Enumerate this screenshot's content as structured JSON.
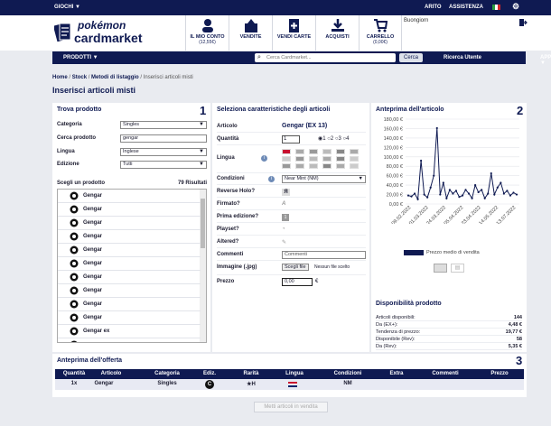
{
  "topbar": {
    "games": "GIOCHI ▼",
    "login": "ARITO",
    "assistance": "ASSISTENZA"
  },
  "header": {
    "logo_top": "pokémon",
    "logo_bottom": "cardmarket",
    "welcome": "Buongiorn",
    "nav": [
      {
        "label": "IL MIO CONTO",
        "sub": "(12,55€)",
        "icon": "user-icon"
      },
      {
        "label": "VENDITE",
        "sub": "",
        "icon": "sell-icon"
      },
      {
        "label": "VENDI CARTE",
        "sub": "",
        "icon": "add-card-icon"
      },
      {
        "label": "ACQUISTI",
        "sub": "",
        "icon": "download-icon"
      },
      {
        "label": "CARRELLO",
        "sub": "(0,00€)",
        "icon": "cart-icon"
      }
    ]
  },
  "menubar": {
    "products": "PRODOTTI ▼",
    "search_placeholder": "Cerca Cardmarket...",
    "search_button": "Cerca",
    "users": "Ricerca Utente",
    "apps": "APPS ▼"
  },
  "breadcrumb": {
    "home": "Home",
    "stock": "Stock",
    "method": "Metodi di listaggio",
    "current": "Inserisci articoli misti"
  },
  "page_title": "Inserisci articoli misti",
  "find_product": {
    "title": "Trova prodotto",
    "number": "1",
    "fields": [
      {
        "label": "Categoria",
        "value": "Singles",
        "type": "select"
      },
      {
        "label": "Cerca prodotto",
        "value": "gengar",
        "type": "input"
      },
      {
        "label": "Lingua",
        "value": "Inglese",
        "type": "select"
      },
      {
        "label": "Edizione",
        "value": "Tutti",
        "type": "select"
      }
    ],
    "results_label": "Scegli un prodotto",
    "results_count": "79 Risultati",
    "results": [
      "Gengar",
      "Gengar",
      "Gengar",
      "Gengar",
      "Gengar",
      "Gengar",
      "Gengar",
      "Gengar",
      "Gengar",
      "Gengar",
      "Gengar ex",
      "Gengar EX"
    ]
  },
  "attributes": {
    "title": "Seleziona caratteristiche degli articoli",
    "article_label": "Articolo",
    "article_value": "Gengar (EX 13)",
    "quantity_label": "Quantità",
    "quantity_value": "1",
    "qty_options": [
      "1",
      "2",
      "3",
      "4"
    ],
    "language_label": "Lingua",
    "condition_label": "Condizioni",
    "condition_value": "Near Mint (NM)",
    "reverse_label": "Reverse Holo?",
    "signed_label": "Firmato?",
    "first_ed_label": "Prima edizione?",
    "playset_label": "Playset?",
    "altered_label": "Altered?",
    "comments_label": "Commenti",
    "comments_value": "Commenti",
    "image_label": "Immagine (.jpg)",
    "file_button": "Scegli file",
    "file_none": "Nessun file scelto",
    "price_label": "Prezzo",
    "price_value": "0,00",
    "currency": "€"
  },
  "preview": {
    "title": "Anteprima dell'articolo",
    "number": "2",
    "legend": "Prezzo medio di vendita",
    "availability_title": "Disponibilità prodotto",
    "availability": [
      {
        "label": "Articoli disponibili:",
        "value": "144"
      },
      {
        "label": "Da (EX+):",
        "value": "4,48 €"
      },
      {
        "label": "Tendenza di prezzo:",
        "value": "19,77 €"
      },
      {
        "label": "Disponibile (Rev):",
        "value": "58"
      },
      {
        "label": "Da (Rev):",
        "value": "5,35 €"
      }
    ]
  },
  "chart_data": {
    "type": "line",
    "title": "",
    "xlabel": "",
    "ylabel": "",
    "ylim": [
      0,
      180
    ],
    "yticks": [
      "0,00 €",
      "20,00 €",
      "40,00 €",
      "60,00 €",
      "80,00 €",
      "100,00 €",
      "120,00 €",
      "140,00 €",
      "160,00 €",
      "180,00 €"
    ],
    "xticks": [
      "09.02.2022",
      "01.03.2022",
      "24.03.2022",
      "05.04.2022",
      "23.04.2022",
      "14.05.2022",
      "13.07.2022"
    ],
    "series": [
      {
        "name": "Prezzo medio di vendita",
        "values": [
          18,
          16,
          22,
          10,
          92,
          20,
          14,
          35,
          60,
          161,
          20,
          45,
          12,
          30,
          22,
          28,
          15,
          18,
          30,
          22,
          12,
          40,
          25,
          30,
          12,
          22,
          65,
          20,
          35,
          45,
          22,
          28,
          18,
          24,
          20
        ]
      }
    ],
    "color": "#0f1a52"
  },
  "offer": {
    "title": "Anteprima dell'offerta",
    "number": "3",
    "columns": [
      "Quantità",
      "Articolo",
      "Categoria",
      "Ediz.",
      "Rarità",
      "Lingua",
      "Condizioni",
      "Extra",
      "Commenti",
      "Prezzo"
    ],
    "row": {
      "qty": "1x",
      "article": "Gengar",
      "category": "Singles",
      "rarity": "★H",
      "condition": "NM"
    },
    "submit": "Metti articoli in vendita"
  }
}
